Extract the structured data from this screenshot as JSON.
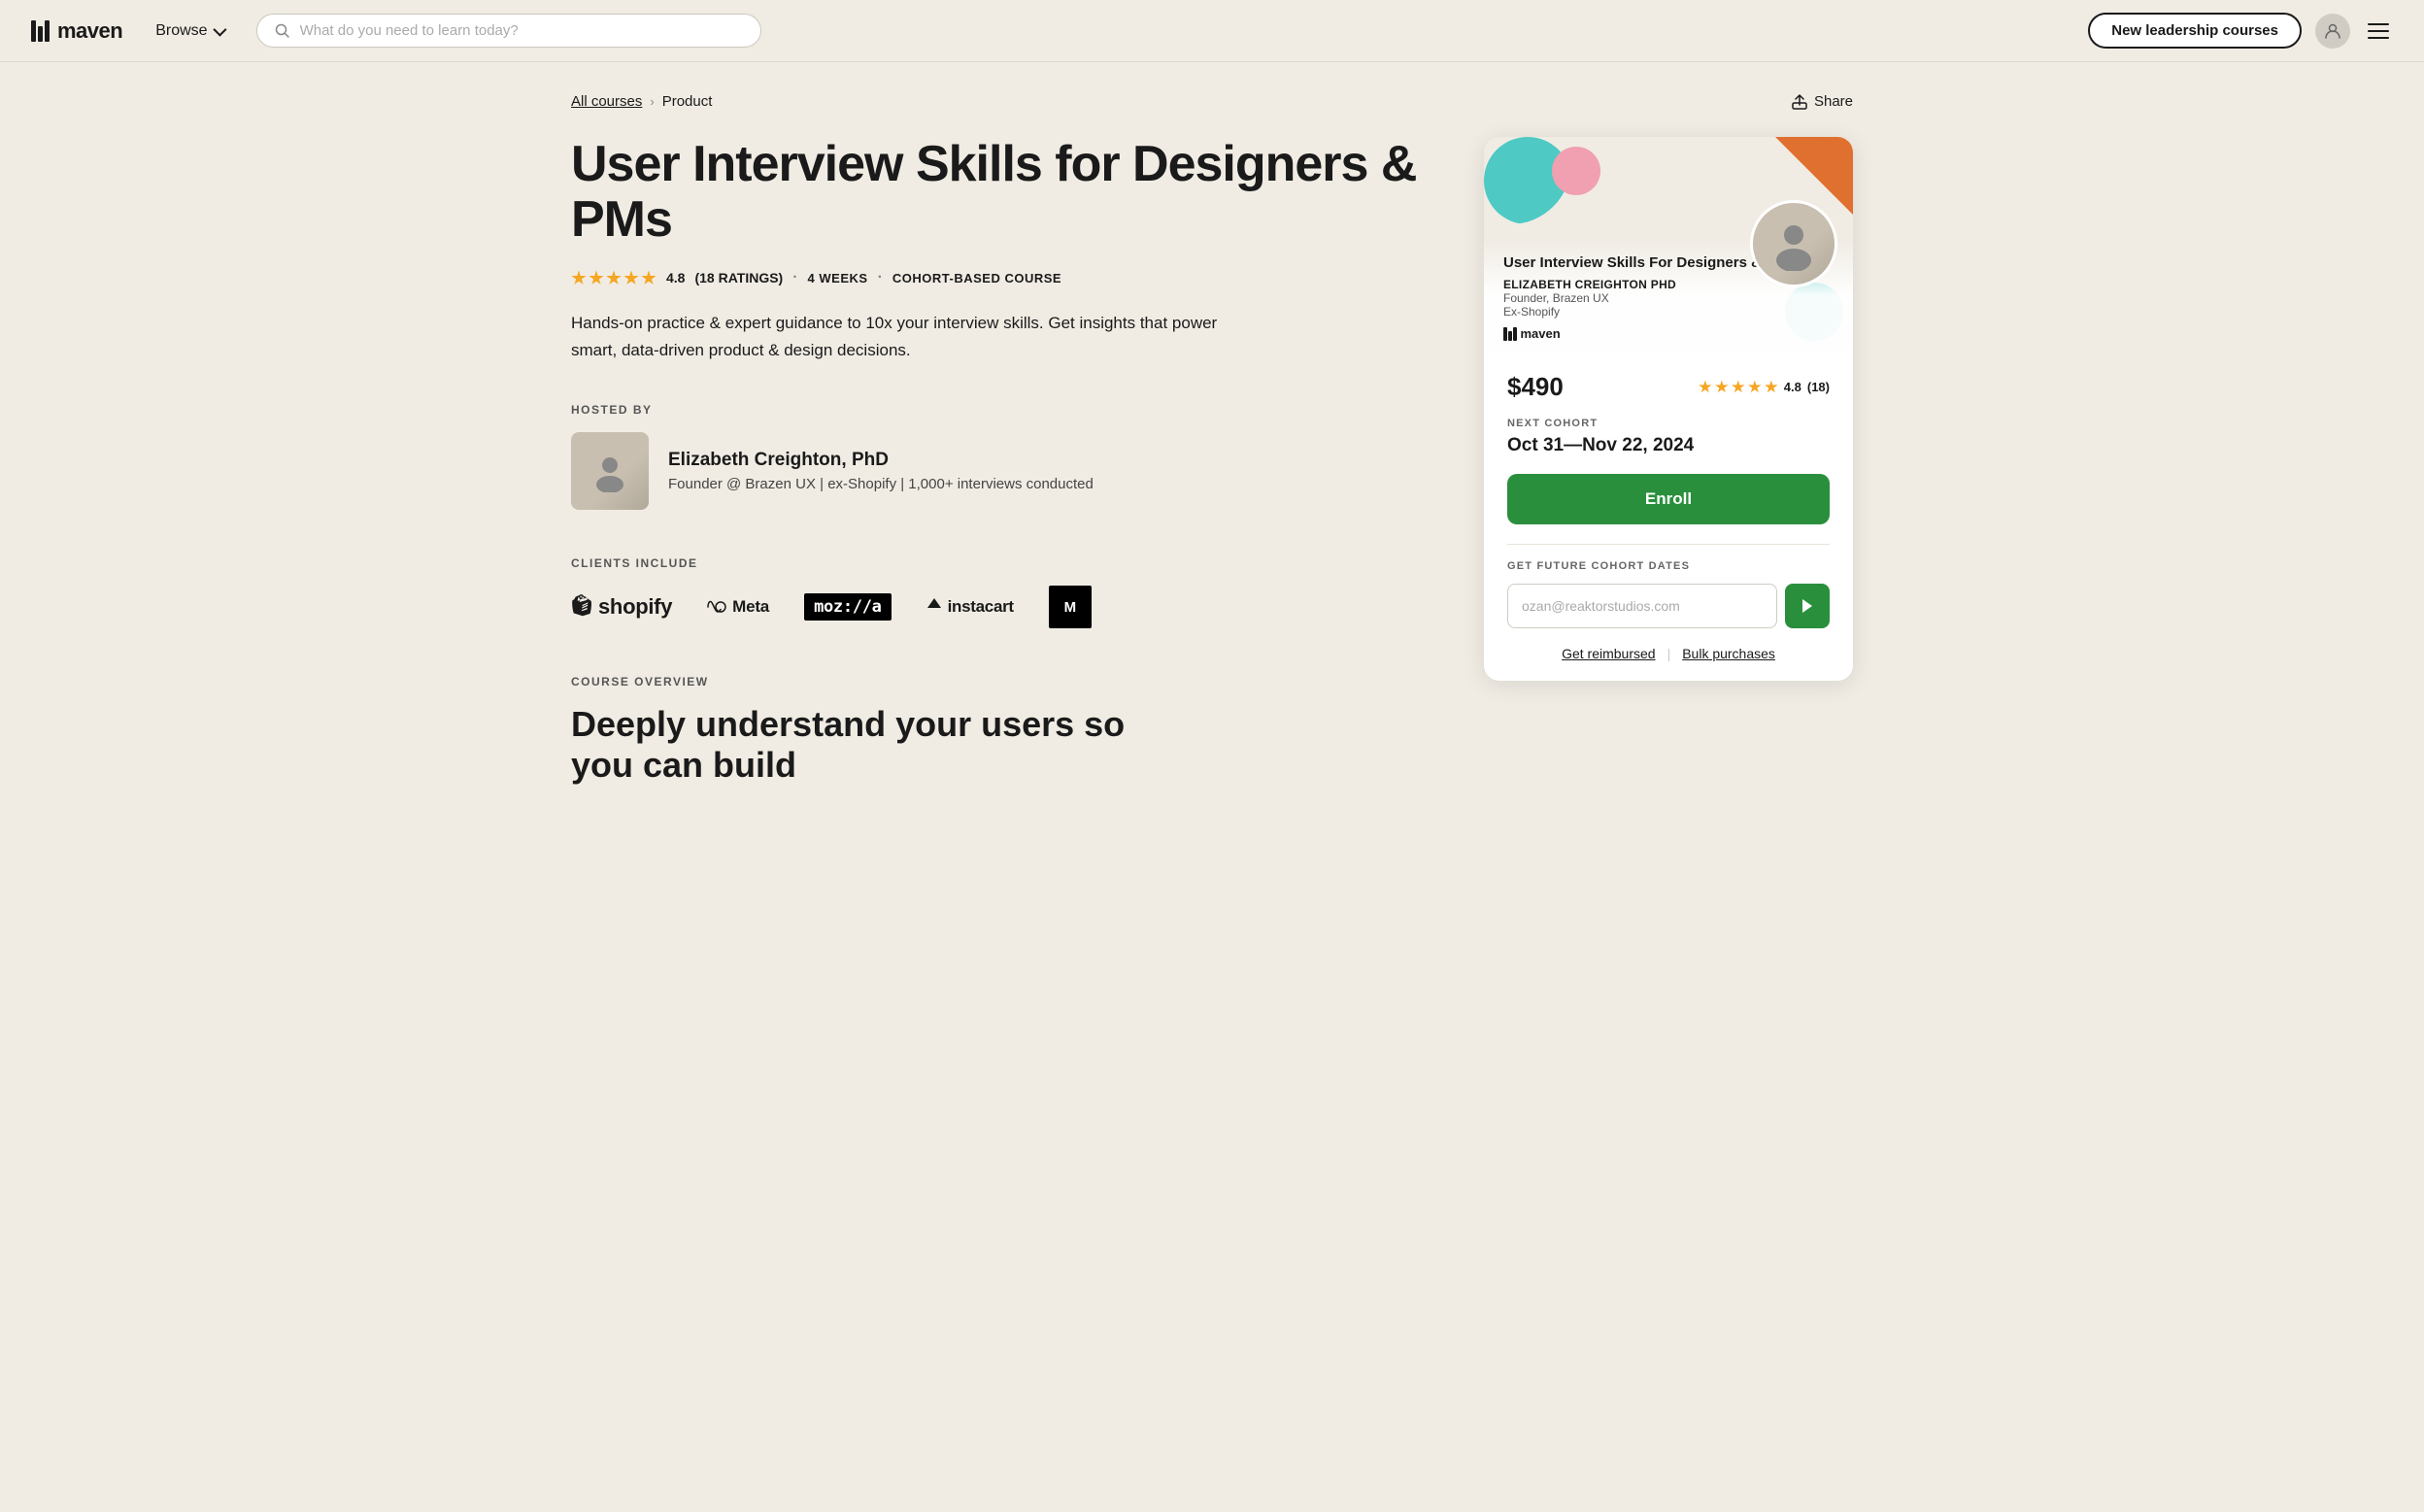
{
  "header": {
    "logo_text": "maven",
    "browse_label": "Browse",
    "search_placeholder": "What do you need to learn today?",
    "new_leadership_label": "New leadership courses",
    "avatar_alt": "User avatar",
    "menu_alt": "Menu"
  },
  "breadcrumb": {
    "all_courses": "All courses",
    "separator": "›",
    "current": "Product",
    "share": "Share"
  },
  "course": {
    "title": "User Interview Skills for Designers & PMs",
    "rating": "4.8",
    "ratings_count": "(18 RATINGS)",
    "duration": "4 WEEKS",
    "type": "COHORT-BASED COURSE",
    "description": "Hands-on practice & expert guidance to 10x your interview skills. Get insights that power smart, data-driven product & design decisions.",
    "hosted_by": "HOSTED BY",
    "host_name": "Elizabeth Creighton, PhD",
    "host_bio": "Founder @ Brazen UX | ex-Shopify | 1,000+ interviews conducted",
    "clients_label": "CLIENTS INCLUDE",
    "clients": [
      "Shopify",
      "Meta",
      "Mozilla",
      "Instacart",
      "MTV"
    ],
    "course_overview_label": "COURSE OVERVIEW",
    "overview_teaser": "Deeply understand your users so you can build"
  },
  "card": {
    "title": "User Interview Skills For Designers & PMs",
    "instructor": "ELIZABETH CREIGHTON PHD",
    "instructor_role": "Founder, Brazen UX",
    "instructor_company": "Ex-Shopify",
    "maven_logo": "maven",
    "price": "$490",
    "rating": "4.8",
    "rating_count": "(18)",
    "next_cohort_label": "NEXT COHORT",
    "cohort_dates": "Oct 31—Nov 22, 2024",
    "enroll_label": "Enroll",
    "future_cohort_label": "GET FUTURE COHORT DATES",
    "email_placeholder": "ozan@reaktorstudios.com",
    "get_reimbursed": "Get reimbursed",
    "bulk_purchases": "Bulk purchases"
  }
}
